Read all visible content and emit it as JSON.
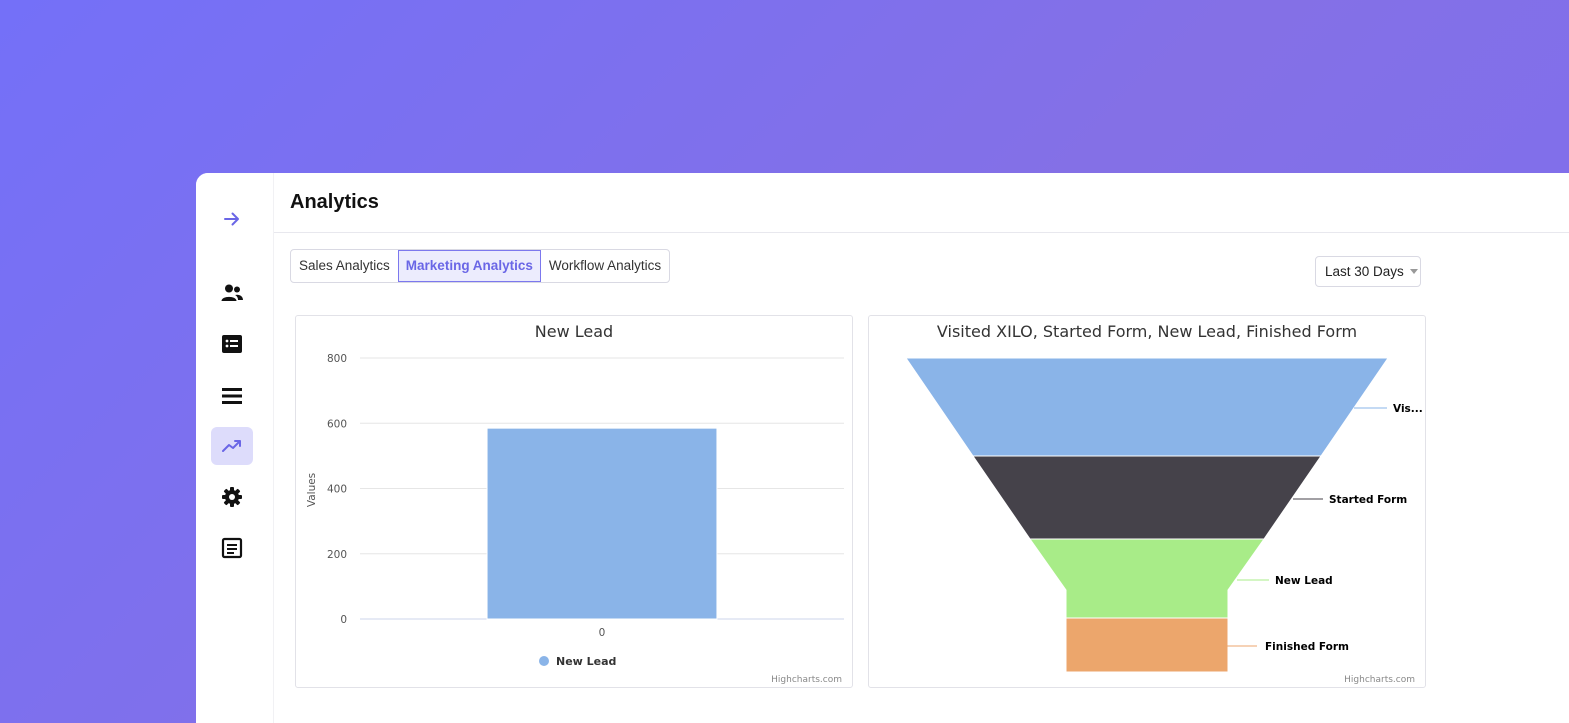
{
  "page": {
    "title": "Analytics"
  },
  "sidebar": {
    "items": [
      {
        "name": "expand",
        "icon": "arrow-right-icon",
        "active": false
      },
      {
        "name": "contacts",
        "icon": "users-icon",
        "active": false
      },
      {
        "name": "list",
        "icon": "list-card-icon",
        "active": false
      },
      {
        "name": "menu",
        "icon": "menu-icon",
        "active": false
      },
      {
        "name": "analytics",
        "icon": "trend-up-icon",
        "active": true
      },
      {
        "name": "settings",
        "icon": "gear-icon",
        "active": false
      },
      {
        "name": "forms",
        "icon": "form-icon",
        "active": false
      }
    ]
  },
  "tabs": [
    {
      "label": "Sales Analytics",
      "active": false
    },
    {
      "label": "Marketing Analytics",
      "active": true
    },
    {
      "label": "Workflow Analytics",
      "active": false
    }
  ],
  "date_range": {
    "selected": "Last 30 Days"
  },
  "colors": {
    "accent": "#6a66e6",
    "bar": "#8ab4e8",
    "funnel": [
      "#8ab4e8",
      "#45424a",
      "#a8ec88",
      "#eca66c"
    ]
  },
  "chart_data": [
    {
      "type": "bar",
      "title": "New Lead",
      "categories": [
        "0"
      ],
      "series": [
        {
          "name": "New Lead",
          "values": [
            585
          ]
        }
      ],
      "ylabel": "Values",
      "ylim": [
        0,
        800
      ],
      "yticks": [
        "0",
        "200",
        "400",
        "600",
        "800"
      ],
      "grid": true,
      "legend": "bottom",
      "credit": "Highcharts.com"
    },
    {
      "type": "funnel",
      "title": "Visited XILO, Started Form, New Lead, Finished Form",
      "categories": [
        "Vis...",
        "Started Form",
        "New Lead",
        "Finished Form"
      ],
      "credit": "Highcharts.com"
    }
  ]
}
